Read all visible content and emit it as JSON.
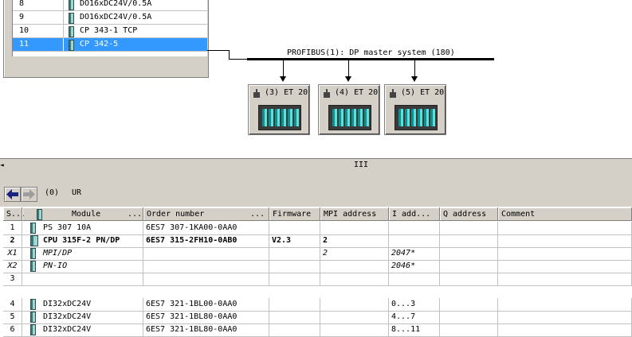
{
  "rack": {
    "rows": [
      {
        "slot": "8",
        "module": "DO16xDC24V/0.5A",
        "selected": false
      },
      {
        "slot": "9",
        "module": "DO16xDC24V/0.5A",
        "selected": false
      },
      {
        "slot": "10",
        "module": "CP 343-1 TCP",
        "selected": false
      },
      {
        "slot": "11",
        "module": "CP 342-5",
        "selected": true
      }
    ]
  },
  "network": {
    "label": "PROFIBUS(1): DP master system (180)",
    "slaves": [
      {
        "label": "(3) ET 20"
      },
      {
        "label": "(4) ET 20"
      },
      {
        "label": "(5) ET 20"
      }
    ]
  },
  "splitter": {
    "grip": "III",
    "left_arrow": "◄"
  },
  "detail": {
    "station_number": "(0)",
    "station_name": "UR",
    "columns": [
      "S...",
      "Module",
      "...",
      "Order number",
      "...",
      "Firmware",
      "MPI address",
      "I add...",
      "Q address",
      "Comment"
    ],
    "rows": [
      {
        "slot": "1",
        "module": "PS 307 10A",
        "order": "6ES7 307-1KA00-0AA0",
        "firmware": "",
        "mpi": "",
        "iaddr": "",
        "qaddr": "",
        "comment": "",
        "style": "normal"
      },
      {
        "slot": "2",
        "module": "CPU 315F-2 PN/DP",
        "order": "6ES7 315-2FH10-0AB0",
        "firmware": "V2.3",
        "mpi": "2",
        "iaddr": "",
        "qaddr": "",
        "comment": "",
        "style": "bold"
      },
      {
        "slot": "X1",
        "module": "MPI/DP",
        "order": "",
        "firmware": "",
        "mpi": "2",
        "iaddr": "2047*",
        "qaddr": "",
        "comment": "",
        "style": "italic"
      },
      {
        "slot": "X2",
        "module": "PN-IO",
        "order": "",
        "firmware": "",
        "mpi": "",
        "iaddr": "2046*",
        "qaddr": "",
        "comment": "",
        "style": "italic"
      },
      {
        "slot": "3",
        "module": "",
        "order": "",
        "firmware": "",
        "mpi": "",
        "iaddr": "",
        "qaddr": "",
        "comment": "",
        "style": "normal"
      },
      {
        "slot": "4",
        "module": "DI32xDC24V",
        "order": "6ES7 321-1BL00-0AA0",
        "firmware": "",
        "mpi": "",
        "iaddr": "0...3",
        "qaddr": "",
        "comment": "",
        "style": "normal"
      },
      {
        "slot": "5",
        "module": "DI32xDC24V",
        "order": "6ES7 321-1BL80-0AA0",
        "firmware": "",
        "mpi": "",
        "iaddr": "4...7",
        "qaddr": "",
        "comment": "",
        "style": "normal"
      },
      {
        "slot": "6",
        "module": "DI32xDC24V",
        "order": "6ES7 321-1BL80-0AA0",
        "firmware": "",
        "mpi": "",
        "iaddr": "8...11",
        "qaddr": "",
        "comment": "",
        "style": "normal"
      }
    ]
  },
  "colors": {
    "selection": "#3399ff",
    "chrome": "#d4d0c8",
    "module_icon": "#3c7a78"
  }
}
